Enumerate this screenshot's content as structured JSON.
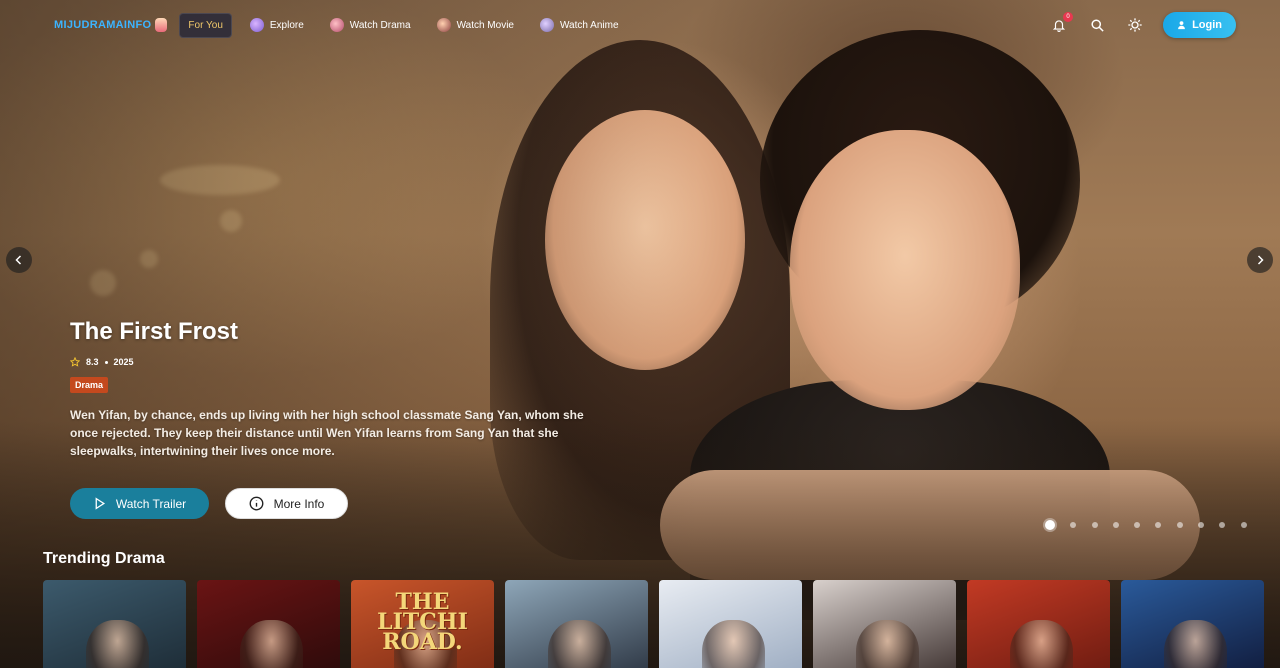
{
  "nav": {
    "logo_text": "MIJUDRAMAINFO",
    "items": [
      {
        "label": "For You",
        "icon": "none",
        "active": true
      },
      {
        "label": "Explore",
        "icon": "explore-icon",
        "active": false
      },
      {
        "label": "Watch Drama",
        "icon": "drama-icon",
        "active": false
      },
      {
        "label": "Watch Movie",
        "icon": "movie-icon",
        "active": false
      },
      {
        "label": "Watch Anime",
        "icon": "anime-icon",
        "active": false
      }
    ],
    "notification_count": "0",
    "login_label": "Login"
  },
  "hero": {
    "title": "The First Frost",
    "rating": "8.3",
    "year": "2025",
    "genre": "Drama",
    "description": "Wen Yifan, by chance, ends up living with her high school classmate Sang Yan, whom she once rejected. They keep their distance until Wen Yifan learns from Sang Yan that she sleepwalks, intertwining their lives once more.",
    "watch_trailer_label": "Watch Trailer",
    "more_info_label": "More Info",
    "slide_count": 10,
    "active_slide": 1
  },
  "trending": {
    "title": "Trending Drama",
    "cards": [
      {
        "poster_text": "",
        "palette": [
          "#3c5a6c",
          "#1c2a34"
        ]
      },
      {
        "poster_text": "",
        "palette": [
          "#6a1414",
          "#2a0a0a"
        ]
      },
      {
        "poster_text": "THE LITCHI ROAD.",
        "palette": [
          "#c8552a",
          "#7a2a14"
        ]
      },
      {
        "poster_text": "",
        "palette": [
          "#8ea6b8",
          "#2a3340"
        ]
      },
      {
        "poster_text": "",
        "palette": [
          "#e8ecf2",
          "#9aaac0"
        ]
      },
      {
        "poster_text": "",
        "palette": [
          "#d8d0cc",
          "#3a2e2c"
        ]
      },
      {
        "poster_text": "",
        "palette": [
          "#c23a24",
          "#6a1a10"
        ]
      },
      {
        "poster_text": "",
        "palette": [
          "#2a5a9a",
          "#101a3a"
        ]
      }
    ]
  },
  "colors": {
    "accent": "#1a7f9c",
    "login": "#1aa8e8",
    "genre_badge": "#c4491e",
    "logo": "#3cb4ff"
  }
}
